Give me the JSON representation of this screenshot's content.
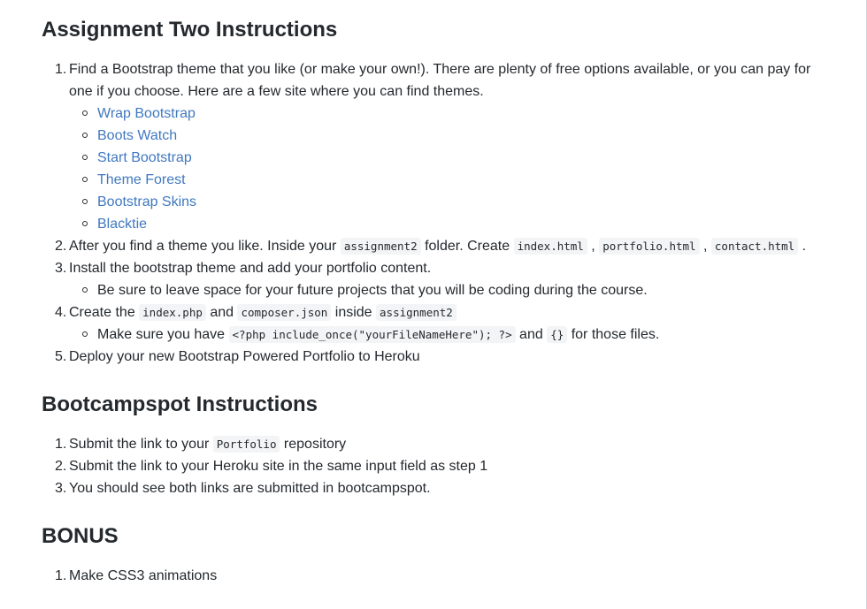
{
  "sections": {
    "assignment_title": "Assignment Two Instructions",
    "bootcamp_title": "Bootcampspot Instructions",
    "bonus_title": "BONUS"
  },
  "assignment": {
    "n1": "1.",
    "step1_text": "Find a Bootstrap theme that you like (or make your own!). There are plenty of free options available, or you can pay for one if you choose. Here are a few site where you can find themes.",
    "links": [
      "Wrap Bootstrap",
      "Boots Watch",
      "Start Bootstrap",
      "Theme Forest",
      "Bootstrap Skins",
      "Blacktie"
    ],
    "n2": "2.",
    "step2_a": "After you find a theme you like. Inside your ",
    "step2_code1": "assignment2",
    "step2_b": " folder. Create ",
    "step2_code2": "index.html",
    "step2_c": " , ",
    "step2_code3": "portfolio.html",
    "step2_d": " , ",
    "step2_code4": "contact.html",
    "step2_e": " .",
    "n3": "3.",
    "step3_text": "Install the bootstrap theme and add your portfolio content.",
    "step3_sub": "Be sure to leave space for your future projects that you will be coding during the course.",
    "n4": "4.",
    "step4_a": "Create the ",
    "step4_code1": "index.php",
    "step4_b": " and ",
    "step4_code2": "composer.json",
    "step4_c": " inside ",
    "step4_code3": "assignment2",
    "step4_sub_a": "Make sure you have ",
    "step4_sub_code1": "<?php include_once(\"yourFileNameHere\"); ?>",
    "step4_sub_b": " and ",
    "step4_sub_code2": "{}",
    "step4_sub_c": " for those files.",
    "n5": "5.",
    "step5_text": "Deploy your new Bootstrap Powered Portfolio to Heroku"
  },
  "bootcamp": {
    "n1": "1.",
    "step1_a": "Submit the link to your ",
    "step1_code": "Portfolio",
    "step1_b": " repository",
    "n2": "2.",
    "step2_text": "Submit the link to your Heroku site in the same input field as step 1",
    "n3": "3.",
    "step3_text": "You should see both links are submitted in bootcampspot."
  },
  "bonus": {
    "n1": "1.",
    "step1_text": "Make CSS3 animations"
  }
}
